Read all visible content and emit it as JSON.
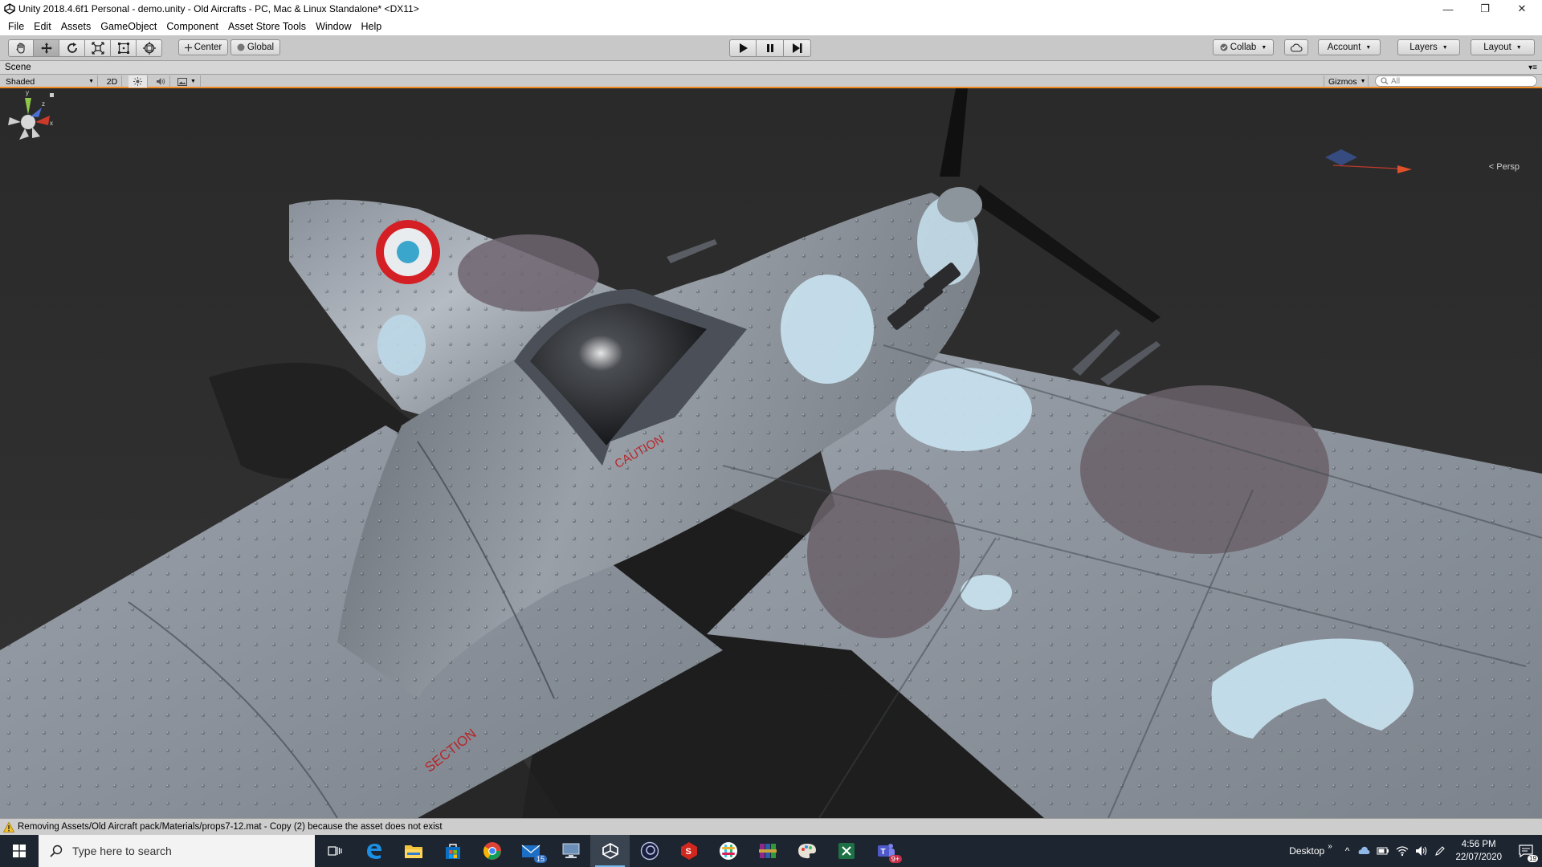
{
  "window": {
    "title": "Unity 2018.4.6f1 Personal - demo.unity - Old Aircrafts - PC, Mac & Linux Standalone* <DX11>",
    "minimize": "—",
    "restore": "❐",
    "close": "✕"
  },
  "menu": [
    "File",
    "Edit",
    "Assets",
    "GameObject",
    "Component",
    "Asset Store Tools",
    "Window",
    "Help"
  ],
  "toolbar": {
    "tools": [
      "hand-tool",
      "move-tool",
      "rotate-tool",
      "scale-tool",
      "rect-tool",
      "transform-tool"
    ],
    "active_tool": "move-tool",
    "pivot_mode": "Center",
    "pivot_rotation": "Global",
    "collab": "Collab",
    "account": "Account",
    "layers": "Layers",
    "layout": "Layout"
  },
  "scene": {
    "tab": "Scene",
    "shading_mode": "Shaded",
    "two_d": "2D",
    "gizmos": "Gizmos",
    "search_placeholder": "All",
    "projection": "Persp",
    "decals": {
      "caution": "CAUTION",
      "section": "SECTION"
    }
  },
  "status": {
    "message": "Removing Assets/Old Aircraft pack/Materials/props7-12.mat - Copy (2) because the asset does not exist"
  },
  "taskbar": {
    "search_placeholder": "Type here to search",
    "apps": [
      "task-view",
      "edge",
      "file-explorer",
      "store",
      "chrome",
      "mail",
      "network-app",
      "unity",
      "cinema4d",
      "substance-painter",
      "slack",
      "winrar",
      "paint-app",
      "excel",
      "teams"
    ],
    "badges": {
      "mail": "15",
      "teams": "9+"
    },
    "desktop_label": "Desktop",
    "time": "4:56 PM",
    "date": "22/07/2020",
    "notifications": "19"
  },
  "colors": {
    "accent_orange": "#f08a24",
    "taskbar": "#1d2530",
    "viewport_bg": "#2f2f2f"
  }
}
